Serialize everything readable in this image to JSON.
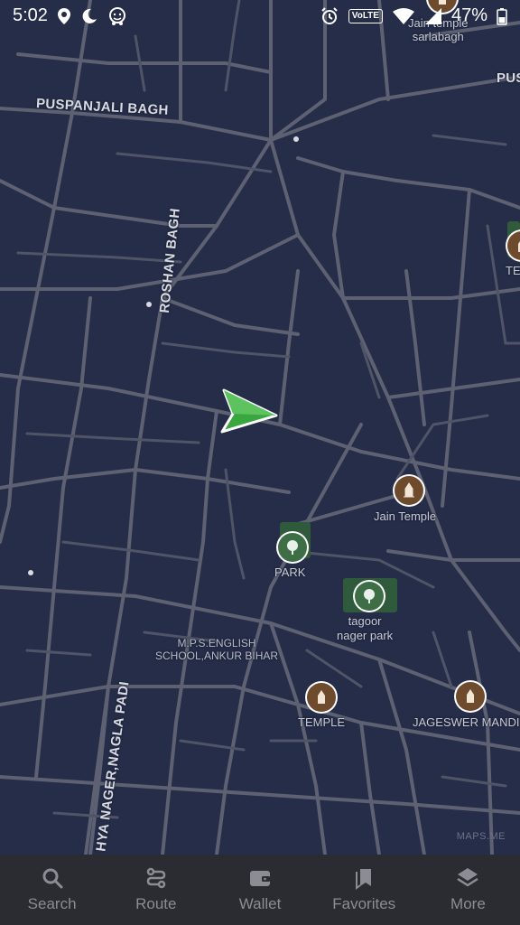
{
  "status_bar": {
    "time": "5:02",
    "volte": "VoLTE",
    "battery": "47%"
  },
  "map": {
    "streets": {
      "puspanjali": "PUSPANJALI BAGH",
      "roshan": "ROSHAN BAGH",
      "nagla": "HYA NAGER,NAGLA PADI",
      "pus_right": "PUS"
    },
    "pois": {
      "jain_temple_top_1": "Jain temple",
      "jain_temple_top_2": "sarlabagh",
      "temple_right": "TE",
      "jain_temple": "Jain Temple",
      "park": "PARK",
      "tagoor_1": "tagoor",
      "tagoor_2": "nager park",
      "school_1": "M.P.S.ENGLISH",
      "school_2": "SCHOOL,ANKUR BIHAR",
      "temple": "TEMPLE",
      "jageswer": "JAGESWER MANDI"
    },
    "watermark": "MAPS.ME",
    "colors": {
      "background": "#252d48",
      "road": "#5d6172",
      "position_arrow": "#3aa63f"
    }
  },
  "bottom_nav": {
    "search": "Search",
    "route": "Route",
    "wallet": "Wallet",
    "favorites": "Favorites",
    "more": "More"
  }
}
